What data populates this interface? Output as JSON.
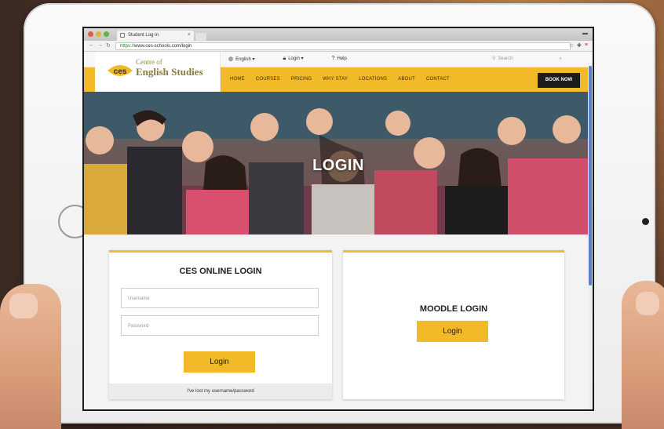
{
  "browser": {
    "tab_title": "Student Log-in",
    "url_scheme": "https://",
    "url_rest": "www.ces-schools.com/login",
    "tab_close": "×"
  },
  "site": {
    "logo": {
      "line1": "Centre of",
      "line2": "English Studies",
      "mark_text": "ces"
    },
    "top_links": [
      "English",
      "Login",
      "Help"
    ],
    "search_placeholder": "Search",
    "menu": [
      "HOME",
      "COURSES",
      "PRICING",
      "WHY STAY",
      "LOCATIONS",
      "ABOUT",
      "CONTACT"
    ],
    "book_now": "BOOK NOW"
  },
  "hero": {
    "title": "LOGIN"
  },
  "ces_login": {
    "title": "CES ONLINE LOGIN",
    "username_placeholder": "Username",
    "password_placeholder": "Password",
    "button": "Login",
    "forgot": "I've lost my username/password"
  },
  "moodle_login": {
    "title": "MOODLE LOGIN",
    "button": "Login"
  },
  "colors": {
    "accent_yellow": "#f2b928",
    "dark_button": "#1d1d1d",
    "url_secure_green": "#1a8a2e"
  }
}
